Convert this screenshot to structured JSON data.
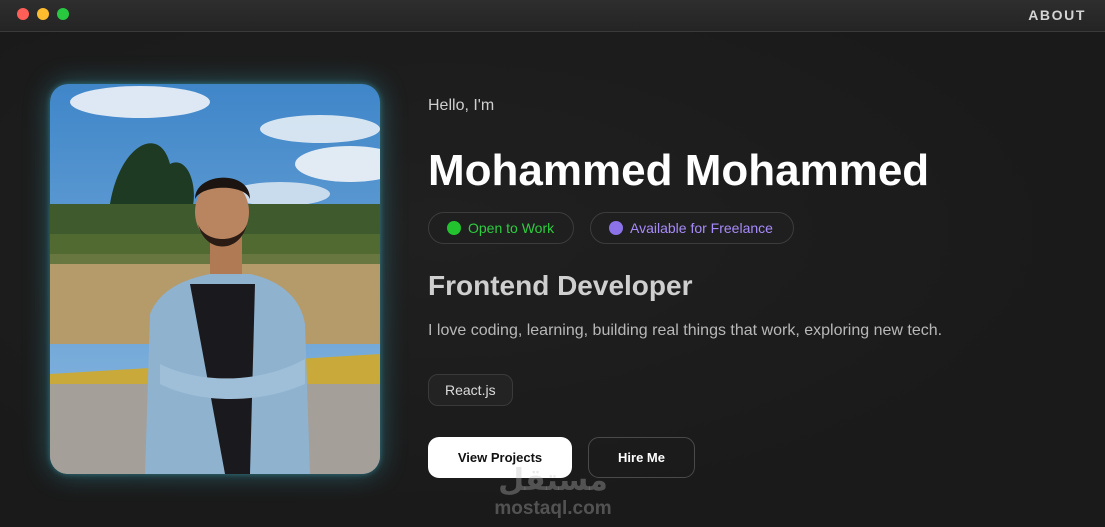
{
  "window": {
    "nav_about": "ABOUT"
  },
  "hero": {
    "greeting": "Hello, I'm",
    "name": "Mohammed Mohammed",
    "badges": [
      {
        "label": "Open to Work",
        "color": "#22c32e"
      },
      {
        "label": "Available for Freelance",
        "color": "#8b72e8"
      }
    ],
    "role": "Frontend Developer",
    "bio": "I love coding, learning, building real things that work, exploring new tech.",
    "tech": [
      "React.js"
    ],
    "buttons": {
      "primary": "View Projects",
      "secondary": "Hire Me"
    }
  },
  "watermark": {
    "arabic": "مستقل",
    "latin": "mostaql.com"
  },
  "colors": {
    "background": "#1c1c1c",
    "photo_glow": "#3caabe",
    "open_to_work": "#2ecc40",
    "freelance": "#a78bfa"
  }
}
